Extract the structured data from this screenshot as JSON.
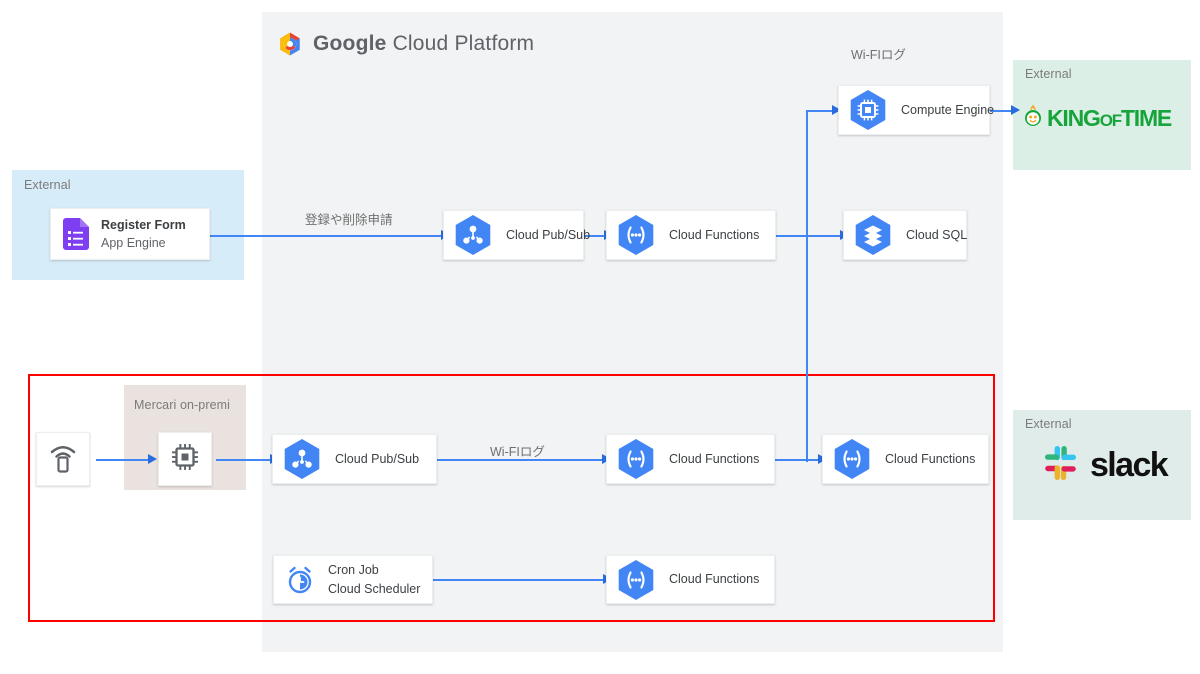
{
  "diagram": {
    "title": "Google Cloud Platform architecture diagram",
    "colors": {
      "gcp_panel": "#f1f3f4",
      "external_blue": "#d7ecf9",
      "external_green": "#dbefe6",
      "onpremi": "#e9e2de",
      "highlight_box": "#ff0000",
      "arrow": "#4285f4",
      "gcp_blue": "#4285f4",
      "forms_purple": "#7e3ff2",
      "kingoftime_green": "#17a53b"
    }
  },
  "gcp": {
    "logo_name": "google-cloud-platform-logo",
    "title_bold": "Google",
    "title_light": " Cloud Platform"
  },
  "panels": {
    "external_left_label": "External",
    "external_kot_label": "External",
    "external_slack_label": "External",
    "onpremi_label": "Mercari on-premi"
  },
  "nodes": {
    "register_form": {
      "line1": "Register Form",
      "line2": "App Engine",
      "icon": "google-forms-icon"
    },
    "pubsub_top": {
      "line1": "Cloud Pub/Sub",
      "icon": "cloud-pubsub-icon"
    },
    "functions_top": {
      "line1": "Cloud Functions",
      "icon": "cloud-functions-icon"
    },
    "compute_engine": {
      "line1": "Compute Engine",
      "icon": "compute-engine-icon"
    },
    "cloud_sql": {
      "line1": "Cloud SQL",
      "icon": "cloud-sql-icon"
    },
    "wifi_device": {
      "icon": "wifi-device-icon"
    },
    "onpremi_server": {
      "icon": "cpu-chip-icon"
    },
    "pubsub_bottom": {
      "line1": "Cloud Pub/Sub",
      "icon": "cloud-pubsub-icon"
    },
    "functions_mid": {
      "line1": "Cloud Functions",
      "icon": "cloud-functions-icon"
    },
    "functions_right": {
      "line1": "Cloud Functions",
      "icon": "cloud-functions-icon"
    },
    "cron_job": {
      "line1": "Cron Job",
      "line2": "Cloud Scheduler",
      "icon": "alarm-clock-icon"
    },
    "functions_cron": {
      "line1": "Cloud Functions",
      "icon": "cloud-functions-icon"
    }
  },
  "edge_labels": {
    "register_request": "登録や削除申請",
    "wifi_log_top": "Wi-FIログ",
    "wifi_log_bottom": "Wi-FIログ"
  },
  "external_logos": {
    "kingoftime": {
      "name": "king-of-time-logo",
      "text_king": "KING",
      "text_of": "OF",
      "text_time": "TIME"
    },
    "slack": {
      "name": "slack-logo",
      "text": "slack"
    }
  }
}
